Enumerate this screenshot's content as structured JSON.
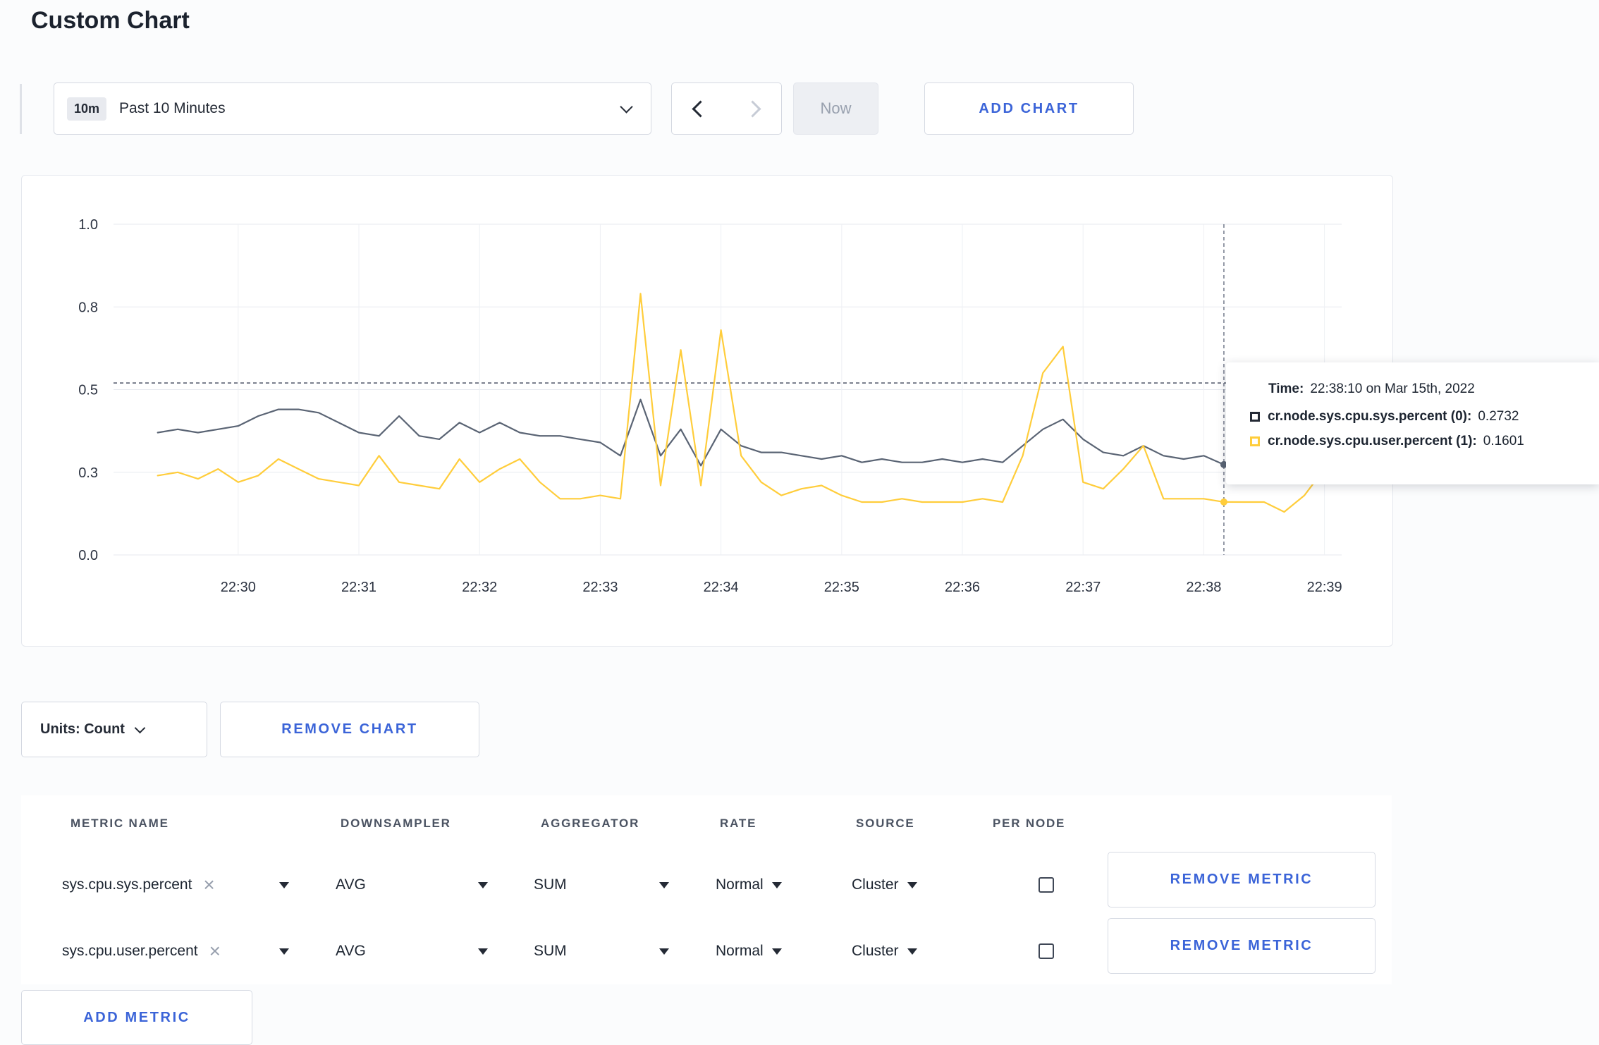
{
  "colors": {
    "accent_blue": "#3b64d8",
    "series_sys": "#5a6474",
    "series_user": "#ffcd3b",
    "grid_h": "#e7eaef",
    "grid_v": "#eef0f4",
    "axis_text": "#2b3240"
  },
  "page": {
    "title": "Custom Chart"
  },
  "toolbar": {
    "range_badge": "10m",
    "range_label": "Past 10 Minutes",
    "now_label": "Now",
    "add_chart_label": "ADD CHART"
  },
  "chart_data": {
    "type": "line",
    "x_tick_labels": [
      "22:30",
      "22:31",
      "22:32",
      "22:33",
      "22:34",
      "22:35",
      "22:36",
      "22:37",
      "22:38",
      "22:39"
    ],
    "x_tick_point_indices": [
      4,
      10,
      16,
      22,
      28,
      34,
      40,
      46,
      52,
      58
    ],
    "y_ticks": [
      {
        "v": 0,
        "label": "0.0"
      },
      {
        "v": 0.25,
        "label": "0.3"
      },
      {
        "v": 0.5,
        "label": "0.5"
      },
      {
        "v": 0.75,
        "label": "0.8"
      },
      {
        "v": 1,
        "label": "1.0"
      }
    ],
    "ylim": [
      0,
      1.0
    ],
    "x_domain_pad": {
      "left": 0.036,
      "right": 0.014
    },
    "grid": true,
    "legend_position": "tooltip",
    "series": [
      {
        "name": "cr.node.sys.cpu.sys.percent",
        "color": "#5a6474",
        "values": [
          0.37,
          0.38,
          0.37,
          0.38,
          0.39,
          0.42,
          0.44,
          0.44,
          0.43,
          0.4,
          0.37,
          0.36,
          0.42,
          0.36,
          0.35,
          0.4,
          0.37,
          0.4,
          0.37,
          0.36,
          0.36,
          0.35,
          0.34,
          0.3,
          0.47,
          0.3,
          0.38,
          0.27,
          0.38,
          0.33,
          0.31,
          0.31,
          0.3,
          0.29,
          0.3,
          0.28,
          0.29,
          0.28,
          0.28,
          0.29,
          0.28,
          0.29,
          0.28,
          0.33,
          0.38,
          0.41,
          0.35,
          0.31,
          0.3,
          0.33,
          0.3,
          0.29,
          0.3,
          0.2732,
          0.3,
          0.32,
          0.31,
          0.3,
          0.31
        ]
      },
      {
        "name": "cr.node.sys.cpu.user.percent",
        "color": "#ffcd3b",
        "values": [
          0.24,
          0.25,
          0.23,
          0.26,
          0.22,
          0.24,
          0.29,
          0.26,
          0.23,
          0.22,
          0.21,
          0.3,
          0.22,
          0.21,
          0.2,
          0.29,
          0.22,
          0.26,
          0.29,
          0.22,
          0.17,
          0.17,
          0.18,
          0.17,
          0.79,
          0.21,
          0.62,
          0.21,
          0.68,
          0.3,
          0.22,
          0.18,
          0.2,
          0.21,
          0.18,
          0.16,
          0.16,
          0.17,
          0.16,
          0.16,
          0.16,
          0.17,
          0.16,
          0.3,
          0.55,
          0.63,
          0.22,
          0.2,
          0.26,
          0.33,
          0.17,
          0.17,
          0.17,
          0.1601,
          0.16,
          0.16,
          0.13,
          0.18,
          0.26
        ]
      }
    ],
    "crosshair": {
      "point_index": 53,
      "h_line_value": 0.52
    },
    "hover_values": [
      0.2732,
      0.1601
    ]
  },
  "tooltip": {
    "time_label": "Time:",
    "time_value": "22:38:10 on Mar 15th, 2022",
    "entries": [
      {
        "label": "cr.node.sys.cpu.sys.percent (0):",
        "value": "0.2732",
        "color": "#242a35"
      },
      {
        "label": "cr.node.sys.cpu.user.percent (1):",
        "value": "0.1601",
        "color": "#ffcd3b"
      }
    ]
  },
  "chart_footer": {
    "units_label": "Units: Count",
    "remove_chart_label": "REMOVE CHART"
  },
  "metrics_table": {
    "headers": [
      "METRIC NAME",
      "DOWNSAMPLER",
      "AGGREGATOR",
      "RATE",
      "SOURCE",
      "PER NODE"
    ],
    "rows": [
      {
        "metric": "sys.cpu.sys.percent",
        "downsampler": "AVG",
        "aggregator": "SUM",
        "rate": "Normal",
        "source": "Cluster",
        "per_node_checked": false,
        "remove_label": "REMOVE METRIC"
      },
      {
        "metric": "sys.cpu.user.percent",
        "downsampler": "AVG",
        "aggregator": "SUM",
        "rate": "Normal",
        "source": "Cluster",
        "per_node_checked": false,
        "remove_label": "REMOVE METRIC"
      }
    ],
    "add_metric_label": "ADD METRIC"
  }
}
